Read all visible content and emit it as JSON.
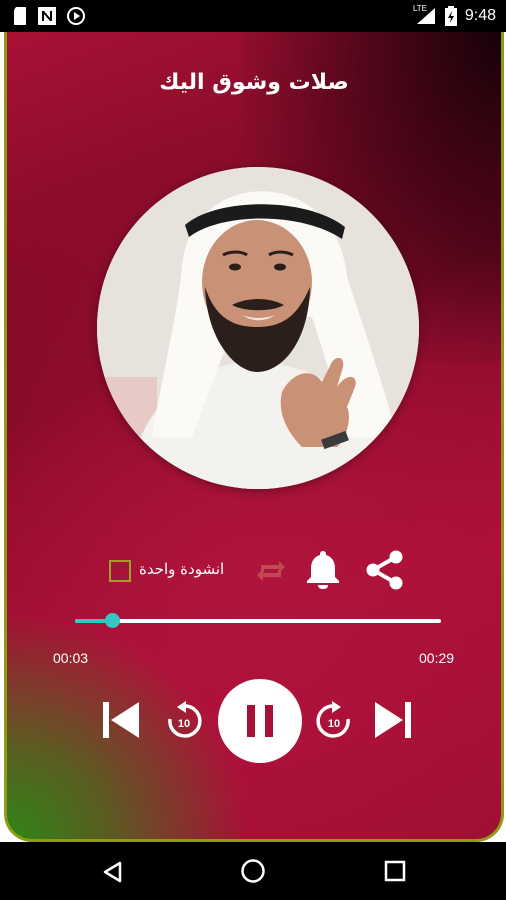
{
  "status_bar": {
    "time": "9:48",
    "network_label": "LTE",
    "icons": [
      "sd-card-icon",
      "n-icon",
      "play-circle-icon",
      "signal-icon",
      "battery-icon"
    ]
  },
  "player": {
    "title": "صلات وشوق اليك",
    "single_track_label": "انشودة واحدة",
    "single_track_checked": false,
    "elapsed_time": "00:03",
    "total_time": "00:29",
    "progress_fraction": 0.1,
    "rewind_seconds": "10",
    "forward_seconds": "10",
    "is_playing": true
  },
  "colors": {
    "accent_seek": "#35c6c3",
    "card_border": "#8f9a18",
    "background_primary": "#a81135",
    "background_corner": "#288c14"
  },
  "icons": {
    "share": "share-icon",
    "notification": "bell-icon",
    "repeat": "repeat-icon",
    "previous": "skip-previous-icon",
    "rewind": "rewind-10-icon",
    "pause": "pause-icon",
    "forward": "forward-10-icon",
    "next": "skip-next-icon"
  },
  "navigation": [
    "back-icon",
    "home-icon",
    "recents-icon"
  ]
}
